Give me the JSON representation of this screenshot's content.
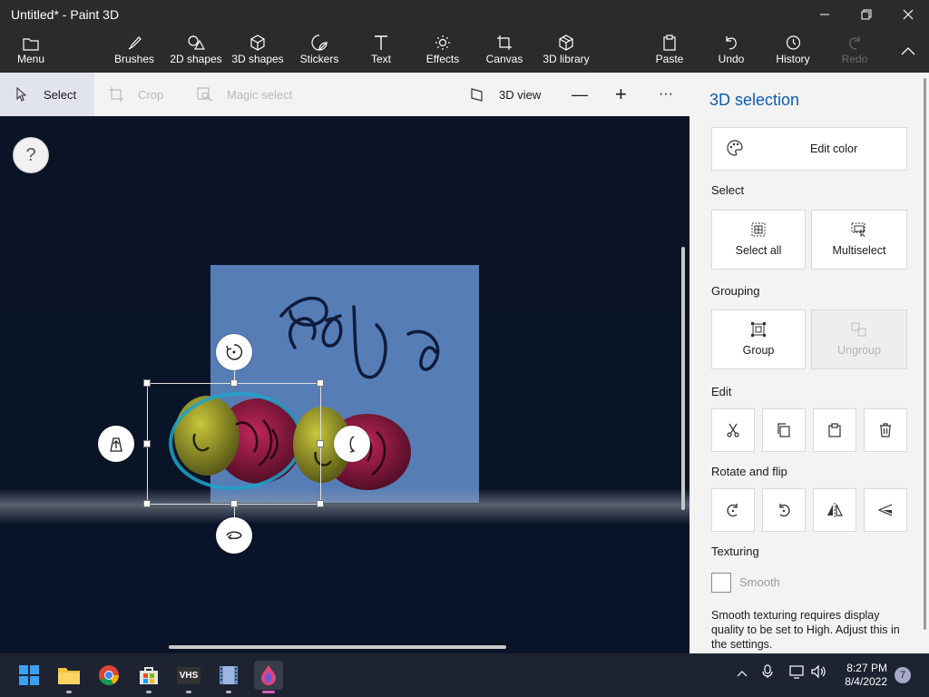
{
  "window": {
    "title": "Untitled* - Paint 3D",
    "minimize_icon": "minimize-icon",
    "maximize_icon": "restore-icon",
    "close_icon": "close-icon"
  },
  "toolbar": {
    "menu_label": "Menu",
    "items": [
      {
        "label": "Brushes",
        "icon": "brush-icon"
      },
      {
        "label": "2D shapes",
        "icon": "2d-shapes-icon"
      },
      {
        "label": "3D shapes",
        "icon": "cube-icon"
      },
      {
        "label": "Stickers",
        "icon": "sticker-icon"
      },
      {
        "label": "Text",
        "icon": "text-icon"
      },
      {
        "label": "Effects",
        "icon": "sun-icon"
      },
      {
        "label": "Canvas",
        "icon": "canvas-icon"
      },
      {
        "label": "3D library",
        "icon": "3d-library-icon"
      }
    ],
    "paste_label": "Paste",
    "undo_label": "Undo",
    "history_label": "History",
    "redo_label": "Redo"
  },
  "subbar": {
    "select_label": "Select",
    "crop_label": "Crop",
    "magic_select_label": "Magic select",
    "view3d_label": "3D view",
    "zoom_out_symbol": "—",
    "zoom_in_symbol": "+",
    "more_symbol": "···"
  },
  "canvas": {
    "help_symbol": "?",
    "drawing_text": "ชUง"
  },
  "panel": {
    "title": "3D selection",
    "edit_color_label": "Edit color",
    "select_heading": "Select",
    "select_all_label": "Select all",
    "multiselect_label": "Multiselect",
    "grouping_heading": "Grouping",
    "group_label": "Group",
    "ungroup_label": "Ungroup",
    "edit_heading": "Edit",
    "rotate_heading": "Rotate and flip",
    "texturing_heading": "Texturing",
    "smooth_label": "Smooth",
    "smooth_note": "Smooth texturing requires display quality to be set to High. Adjust this in the settings."
  },
  "taskbar": {
    "apps": [
      "start-icon",
      "file-explorer-icon",
      "chrome-icon",
      "store-icon",
      "vhs-icon",
      "video-icon",
      "paint3d-icon"
    ],
    "vhs_label": "VHS",
    "time": "8:27 PM",
    "date": "8/4/2022",
    "notification_count": "7"
  },
  "colors": {
    "accent": "#0b5cad",
    "chrome": "#2b2b2b",
    "canvas_bg": "#0b1426",
    "plane": "#5c83bf",
    "selection": "#1da3c9"
  }
}
